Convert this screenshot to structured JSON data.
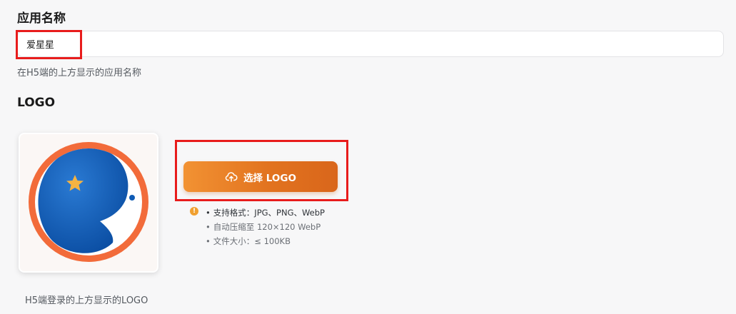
{
  "app_name": {
    "title": "应用名称",
    "value": "爱星星",
    "hint": "在H5端的上方显示的应用名称"
  },
  "logo": {
    "title": "LOGO",
    "select_button_label": "选择 LOGO",
    "info_icon_glyph": "!",
    "bullet": "•",
    "requirements": [
      "支持格式：JPG、PNG、WebP",
      "自动压缩至 120×120 WebP",
      "文件大小：≤ 100KB"
    ],
    "hint": "H5端登录的上方显示的LOGO",
    "colors": {
      "ring": "#f26b3a",
      "moon_blue": "#0f5bb5",
      "star": "#f5b342",
      "button_accent": "#e57a22"
    }
  }
}
